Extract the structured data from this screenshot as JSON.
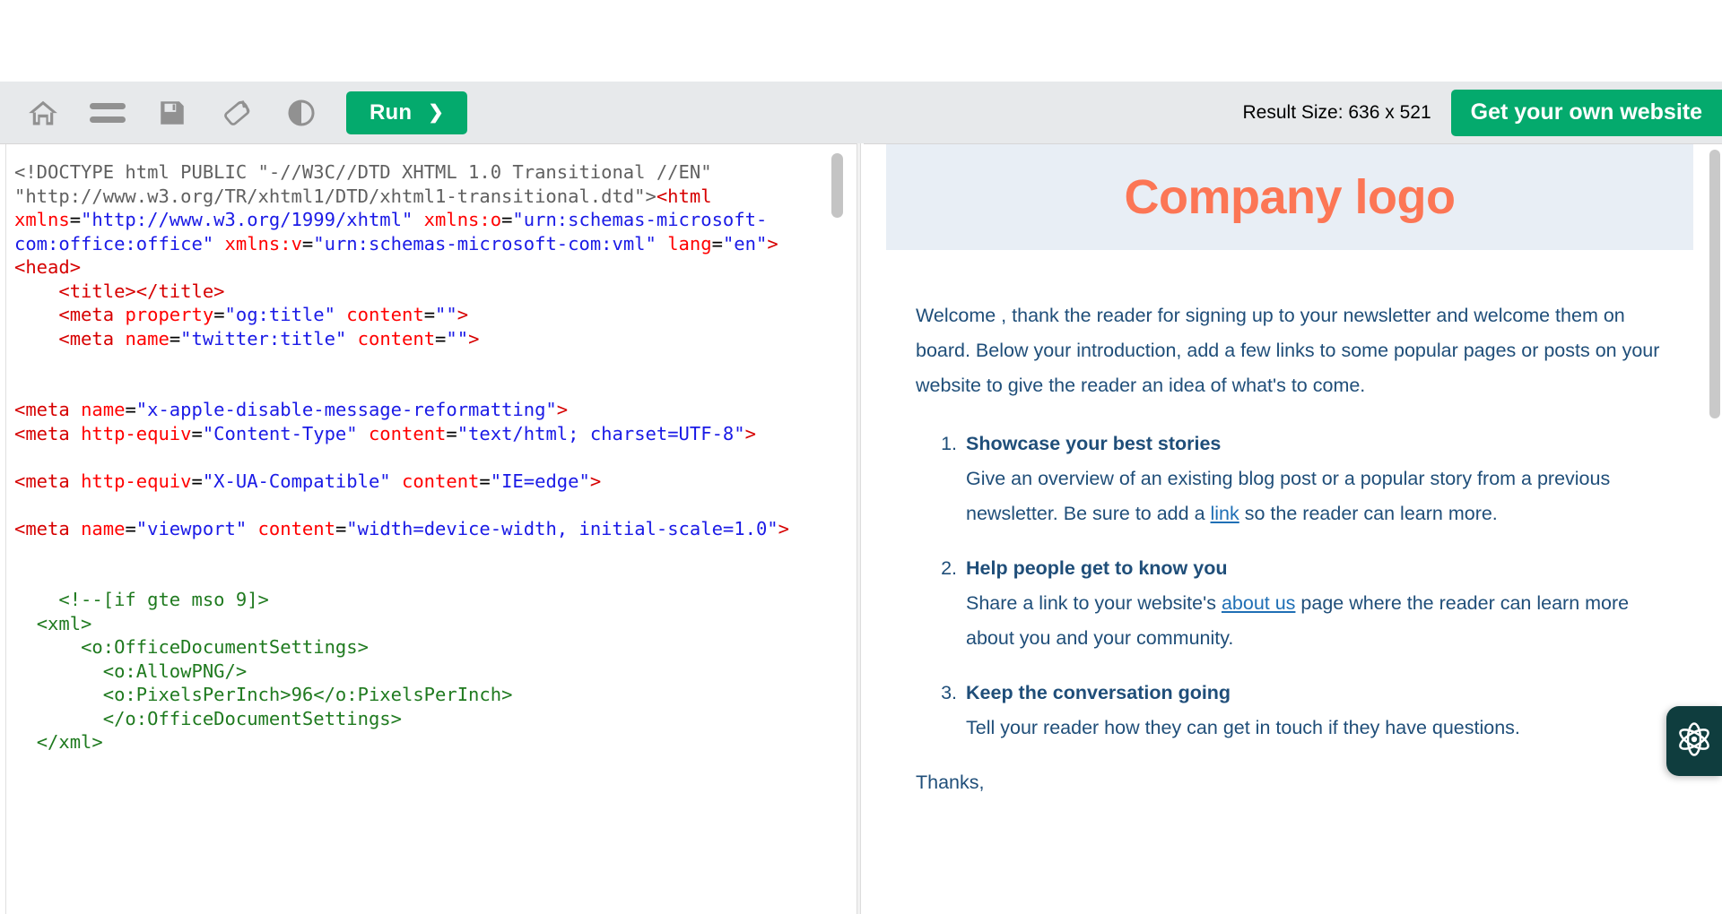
{
  "toolbar": {
    "icons": [
      {
        "name": "home-icon",
        "label": "Home"
      },
      {
        "name": "menu-icon",
        "label": "Menu"
      },
      {
        "name": "save-icon",
        "label": "Save"
      },
      {
        "name": "rotate-layout-icon",
        "label": "Change Orientation"
      },
      {
        "name": "contrast-icon",
        "label": "Toggle Dark Mode"
      }
    ],
    "run_label": "Run",
    "run_chevron": "❯",
    "result_size_label": "Result Size: 636 x 521",
    "get_website_label": "Get your own website",
    "accent_green": "#04aa6d",
    "bar_background": "#e7e9eb"
  },
  "editor": {
    "language": "html",
    "colors": {
      "tag": "#d60000",
      "attribute": "#ff0000",
      "value": "#1a1ae6",
      "comment": "#1f7a1f",
      "doctype": "#606060"
    },
    "lines": [
      {
        "type": "mixed",
        "parts": [
          {
            "t": "doctype",
            "s": "<!DOCTYPE html PUBLIC \"-//W3C//DTD XHTML 1.0 Transitional //EN\" \"http://www.w3.org/TR/xhtml1/DTD/xhtml1-transitional.dtd\">"
          },
          {
            "t": "tag",
            "s": "<html"
          },
          {
            "t": "plain",
            "s": " "
          },
          {
            "t": "attr",
            "s": "xmlns"
          },
          {
            "t": "plain",
            "s": "="
          },
          {
            "t": "val",
            "s": "\"http://www.w3.org/1999/xhtml\""
          },
          {
            "t": "plain",
            "s": " "
          },
          {
            "t": "attr",
            "s": "xmlns:o"
          },
          {
            "t": "plain",
            "s": "="
          },
          {
            "t": "val",
            "s": "\"urn:schemas-microsoft-com:office:office\""
          },
          {
            "t": "plain",
            "s": " "
          },
          {
            "t": "attr",
            "s": "xmlns:v"
          },
          {
            "t": "plain",
            "s": "="
          },
          {
            "t": "val",
            "s": "\"urn:schemas-microsoft-com:vml\""
          },
          {
            "t": "plain",
            "s": " "
          },
          {
            "t": "attr",
            "s": "lang"
          },
          {
            "t": "plain",
            "s": "="
          },
          {
            "t": "val",
            "s": "\"en\""
          },
          {
            "t": "tag",
            "s": ">"
          },
          {
            "t": "tag",
            "s": "<head>"
          }
        ]
      },
      {
        "type": "mixed",
        "indent": 4,
        "parts": [
          {
            "t": "tag",
            "s": "<title>"
          },
          {
            "t": "tag",
            "s": "</title>"
          }
        ]
      },
      {
        "type": "mixed",
        "indent": 4,
        "parts": [
          {
            "t": "tag",
            "s": "<meta"
          },
          {
            "t": "plain",
            "s": " "
          },
          {
            "t": "attr",
            "s": "property"
          },
          {
            "t": "plain",
            "s": "="
          },
          {
            "t": "val",
            "s": "\"og:title\""
          },
          {
            "t": "plain",
            "s": " "
          },
          {
            "t": "attr",
            "s": "content"
          },
          {
            "t": "plain",
            "s": "="
          },
          {
            "t": "val",
            "s": "\"\""
          },
          {
            "t": "tag",
            "s": ">"
          }
        ]
      },
      {
        "type": "mixed",
        "indent": 4,
        "parts": [
          {
            "t": "tag",
            "s": "<meta"
          },
          {
            "t": "plain",
            "s": " "
          },
          {
            "t": "attr",
            "s": "name"
          },
          {
            "t": "plain",
            "s": "="
          },
          {
            "t": "val",
            "s": "\"twitter:title\""
          },
          {
            "t": "plain",
            "s": " "
          },
          {
            "t": "attr",
            "s": "content"
          },
          {
            "t": "plain",
            "s": "="
          },
          {
            "t": "val",
            "s": "\"\""
          },
          {
            "t": "tag",
            "s": ">"
          }
        ]
      },
      {
        "type": "blank"
      },
      {
        "type": "blank"
      },
      {
        "type": "mixed",
        "parts": [
          {
            "t": "tag",
            "s": "<meta"
          },
          {
            "t": "plain",
            "s": " "
          },
          {
            "t": "attr",
            "s": "name"
          },
          {
            "t": "plain",
            "s": "="
          },
          {
            "t": "val",
            "s": "\"x-apple-disable-message-reformatting\""
          },
          {
            "t": "tag",
            "s": ">"
          }
        ]
      },
      {
        "type": "mixed",
        "parts": [
          {
            "t": "tag",
            "s": "<meta"
          },
          {
            "t": "plain",
            "s": " "
          },
          {
            "t": "attr",
            "s": "http-equiv"
          },
          {
            "t": "plain",
            "s": "="
          },
          {
            "t": "val",
            "s": "\"Content-Type\""
          },
          {
            "t": "plain",
            "s": " "
          },
          {
            "t": "attr",
            "s": "content"
          },
          {
            "t": "plain",
            "s": "="
          },
          {
            "t": "val",
            "s": "\"text/html; charset=UTF-8\""
          },
          {
            "t": "tag",
            "s": ">"
          }
        ]
      },
      {
        "type": "blank"
      },
      {
        "type": "mixed",
        "parts": [
          {
            "t": "tag",
            "s": "<meta"
          },
          {
            "t": "plain",
            "s": " "
          },
          {
            "t": "attr",
            "s": "http-equiv"
          },
          {
            "t": "plain",
            "s": "="
          },
          {
            "t": "val",
            "s": "\"X-UA-Compatible\""
          },
          {
            "t": "plain",
            "s": " "
          },
          {
            "t": "attr",
            "s": "content"
          },
          {
            "t": "plain",
            "s": "="
          },
          {
            "t": "val",
            "s": "\"IE=edge\""
          },
          {
            "t": "tag",
            "s": ">"
          }
        ]
      },
      {
        "type": "blank"
      },
      {
        "type": "mixed",
        "parts": [
          {
            "t": "tag",
            "s": "<meta"
          },
          {
            "t": "plain",
            "s": " "
          },
          {
            "t": "attr",
            "s": "name"
          },
          {
            "t": "plain",
            "s": "="
          },
          {
            "t": "val",
            "s": "\"viewport\""
          },
          {
            "t": "plain",
            "s": " "
          },
          {
            "t": "attr",
            "s": "content"
          },
          {
            "t": "plain",
            "s": "="
          },
          {
            "t": "val",
            "s": "\"width=device-width, initial-scale=1.0\""
          },
          {
            "t": "tag",
            "s": ">"
          }
        ]
      },
      {
        "type": "blank"
      },
      {
        "type": "blank"
      },
      {
        "type": "mixed",
        "indent": 4,
        "parts": [
          {
            "t": "comment",
            "s": "<!--[if gte mso 9]>"
          }
        ]
      },
      {
        "type": "mixed",
        "indent": 2,
        "parts": [
          {
            "t": "comment",
            "s": "<xml>"
          }
        ]
      },
      {
        "type": "mixed",
        "indent": 6,
        "parts": [
          {
            "t": "comment",
            "s": "<o:OfficeDocumentSettings>"
          }
        ]
      },
      {
        "type": "mixed",
        "indent": 8,
        "parts": [
          {
            "t": "comment",
            "s": "<o:AllowPNG/>"
          }
        ]
      },
      {
        "type": "mixed",
        "indent": 8,
        "parts": [
          {
            "t": "comment",
            "s": "<o:PixelsPerInch>96</o:PixelsPerInch>"
          }
        ]
      },
      {
        "type": "mixed",
        "indent": 8,
        "parts": [
          {
            "t": "comment",
            "s": "</o:OfficeDocumentSettings>"
          }
        ]
      },
      {
        "type": "mixed",
        "indent": 2,
        "parts": [
          {
            "t": "comment",
            "s": "</xml>"
          }
        ]
      }
    ]
  },
  "preview": {
    "logo_text": "Company logo",
    "logo_color": "#fc7655",
    "header_background": "#e8eef5",
    "body_text_color": "#1f4e79",
    "link_color": "#1f6fb5",
    "intro": "Welcome , thank the reader for signing up to your newsletter and welcome them on board. Below your introduction, add a few links to some popular pages or posts on your website to give the reader an idea of what's to come.",
    "points": [
      {
        "title": "Showcase your best stories",
        "body_before": "Give an overview of an existing blog post or a popular story from a previous newsletter. Be sure to add a ",
        "link": "link",
        "body_after": " so the reader can learn more."
      },
      {
        "title": "Help people get to know you",
        "body_before": "Share a link to your website's ",
        "link": "about us",
        "body_after": " page where the reader can learn more about you and your community."
      },
      {
        "title": "Keep the conversation going",
        "body_before": "Tell your reader how they can get in touch if they have questions.",
        "link": "",
        "body_after": ""
      }
    ],
    "signoff": "Thanks,"
  },
  "chat_widget": {
    "name": "chat-widget",
    "background": "#0f3d3e"
  }
}
